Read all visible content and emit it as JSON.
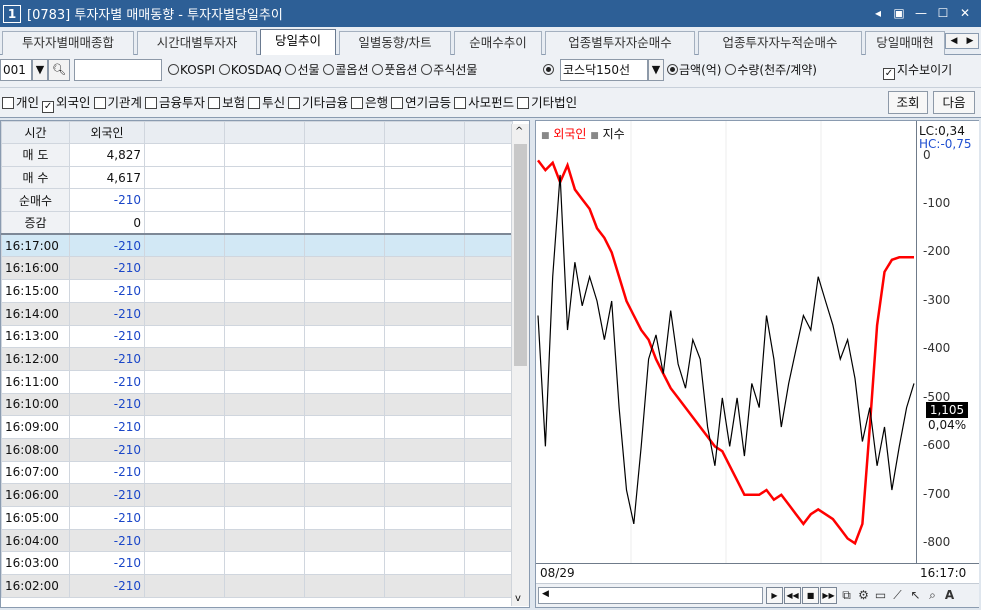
{
  "window": {
    "num": "1",
    "title": "[0783] 투자자별 매매동향 - 투자자별당일추이",
    "ctrl": [
      "◂",
      "▣",
      "—",
      "☐",
      "✕"
    ]
  },
  "tabs": [
    "투자자별매매종합",
    "시간대별투자자",
    "당일추이",
    "일별동향/차트",
    "순매수추이",
    "업종별투자자순매수",
    "업종투자자누적순매수",
    "당일매매현"
  ],
  "active_tab": 2,
  "toolbar": {
    "code": "001",
    "radios": [
      {
        "label": "KOSPI",
        "on": false
      },
      {
        "label": "KOSDAQ",
        "on": false
      },
      {
        "label": "선물",
        "on": false
      },
      {
        "label": "콜옵션",
        "on": false
      },
      {
        "label": "풋옵션",
        "on": false
      },
      {
        "label": "주식선물",
        "on": true
      }
    ],
    "select_value": "코스닥150선",
    "unit_radios": [
      {
        "label": "금액(억)",
        "on": true
      },
      {
        "label": "수량(천주/계약)",
        "on": false
      }
    ],
    "index_check_label": "지수보이기"
  },
  "investors": [
    {
      "label": "개인",
      "checked": false
    },
    {
      "label": "외국인",
      "checked": true
    },
    {
      "label": "기관계",
      "checked": false
    },
    {
      "label": "금융투자",
      "checked": false
    },
    {
      "label": "보험",
      "checked": false
    },
    {
      "label": "투신",
      "checked": false
    },
    {
      "label": "기타금융",
      "checked": false
    },
    {
      "label": "은행",
      "checked": false
    },
    {
      "label": "연기금등",
      "checked": false
    },
    {
      "label": "사모펀드",
      "checked": false
    },
    {
      "label": "기타법인",
      "checked": false
    }
  ],
  "buttons": {
    "query": "조회",
    "next": "다음"
  },
  "grid": {
    "headers": [
      "시간",
      "외국인"
    ],
    "summary": [
      {
        "label": "매 도",
        "value": "4,827"
      },
      {
        "label": "매 수",
        "value": "4,617"
      },
      {
        "label": "순매수",
        "value": "-210"
      },
      {
        "label": "증감",
        "value": "0"
      }
    ],
    "rows": [
      {
        "time": "16:17:00",
        "value": "-210"
      },
      {
        "time": "16:16:00",
        "value": "-210"
      },
      {
        "time": "16:15:00",
        "value": "-210"
      },
      {
        "time": "16:14:00",
        "value": "-210"
      },
      {
        "time": "16:13:00",
        "value": "-210"
      },
      {
        "time": "16:12:00",
        "value": "-210"
      },
      {
        "time": "16:11:00",
        "value": "-210"
      },
      {
        "time": "16:10:00",
        "value": "-210"
      },
      {
        "time": "16:09:00",
        "value": "-210"
      },
      {
        "time": "16:08:00",
        "value": "-210"
      },
      {
        "time": "16:07:00",
        "value": "-210"
      },
      {
        "time": "16:06:00",
        "value": "-210"
      },
      {
        "time": "16:05:00",
        "value": "-210"
      },
      {
        "time": "16:04:00",
        "value": "-210"
      },
      {
        "time": "16:03:00",
        "value": "-210"
      },
      {
        "time": "16:02:00",
        "value": "-210"
      }
    ]
  },
  "chart": {
    "legend": [
      "외국인",
      "지수"
    ],
    "lc": "LC:0,34",
    "hc": "HC:-0,75",
    "price_tag": "1,105",
    "pct_tag": "0,04%",
    "x_start": "08/29",
    "x_end": "16:17:0"
  },
  "chart_data": {
    "type": "line",
    "title": "",
    "xlabel": "",
    "ylabel": "",
    "yticks": [
      0,
      -100,
      -200,
      -300,
      -400,
      -500,
      -600,
      -700,
      -800
    ],
    "ylim": [
      -820,
      30
    ],
    "series": [
      {
        "name": "외국인",
        "color": "#ff0000",
        "values": [
          -10,
          -30,
          -15,
          -55,
          -20,
          -70,
          -90,
          -110,
          -150,
          -170,
          -200,
          -250,
          -300,
          -330,
          -360,
          -380,
          -420,
          -450,
          -480,
          -500,
          -520,
          -540,
          -560,
          -580,
          -600,
          -610,
          -640,
          -670,
          -700,
          -700,
          -700,
          -690,
          -710,
          -700,
          -720,
          -740,
          -760,
          -740,
          -730,
          -740,
          -750,
          -770,
          -790,
          -800,
          -760,
          -560,
          -350,
          -240,
          -215,
          -210,
          -210,
          -210
        ]
      },
      {
        "name": "지수",
        "color": "#000000",
        "values": [
          -330,
          -600,
          -250,
          -40,
          -360,
          -220,
          -310,
          -250,
          -300,
          -380,
          -300,
          -520,
          -690,
          -760,
          -600,
          -420,
          -370,
          -450,
          -320,
          -430,
          -480,
          -380,
          -420,
          -560,
          -640,
          -500,
          -600,
          -500,
          -620,
          -470,
          -520,
          -330,
          -420,
          -560,
          -470,
          -400,
          -330,
          -360,
          -250,
          -300,
          -350,
          -420,
          -380,
          -460,
          -590,
          -520,
          -640,
          -560,
          -690,
          -600,
          -520,
          -470
        ]
      }
    ]
  },
  "colors": {
    "title_bg": "#2d5f96",
    "neg_text": "#1a46c8",
    "foreign_line": "#ff0000",
    "index_line": "#000000",
    "hc_text": "#2050d0"
  }
}
